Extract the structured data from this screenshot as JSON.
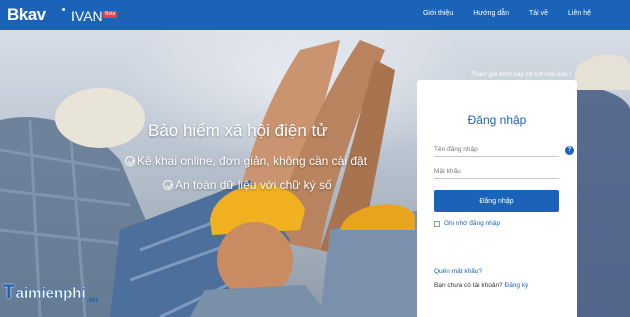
{
  "brand": {
    "logo": "Bkav",
    "product": "IVAN",
    "badge": "Beta"
  },
  "nav": {
    "items": [
      "Giới thiệu",
      "Hướng dẫn",
      "Tải về",
      "Liên hệ"
    ]
  },
  "hero": {
    "tagline": "Tham gia hôm nay lợi ích mai sau !",
    "title": "Bảo hiểm xã hội điện tử",
    "points": [
      "Kê khai online, đơn giản, không cần cài đặt",
      "An toàn dữ liệu với chữ ký số"
    ]
  },
  "login": {
    "title": "Đăng nhập",
    "username_placeholder": "Tên đăng nhập",
    "password_placeholder": "Mật khẩu",
    "submit_label": "Đăng nhập",
    "remember_label": "Ghi nhớ đăng nhập",
    "forgot_label": "Quên mật khẩu?",
    "no_account_text": "Bạn chưa có tài khoản?",
    "register_label": "Đăng ký",
    "help_icon": "?"
  },
  "watermark": {
    "t": "T",
    "text": "aimienphi",
    "suffix": ".vn"
  },
  "colors": {
    "primary": "#1b63b8",
    "badge": "#e8403a"
  }
}
